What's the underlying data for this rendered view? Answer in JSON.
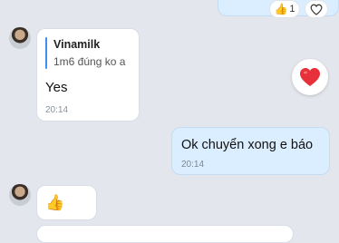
{
  "top_message": {
    "reaction_emoji": "👍",
    "reaction_count": "1",
    "heart_outline_icon": "heart-outline-icon"
  },
  "incoming_1": {
    "quote_title": "Vinamilk",
    "quote_text": "1m6 đúng ko a",
    "text": "Yes",
    "time": "20:14"
  },
  "reaction": {
    "icon": "heart-icon",
    "color": "#e8303a"
  },
  "outgoing_1": {
    "text": "Ok chuyển xong e báo",
    "time": "20:14"
  },
  "incoming_2": {
    "emoji": "👍"
  }
}
